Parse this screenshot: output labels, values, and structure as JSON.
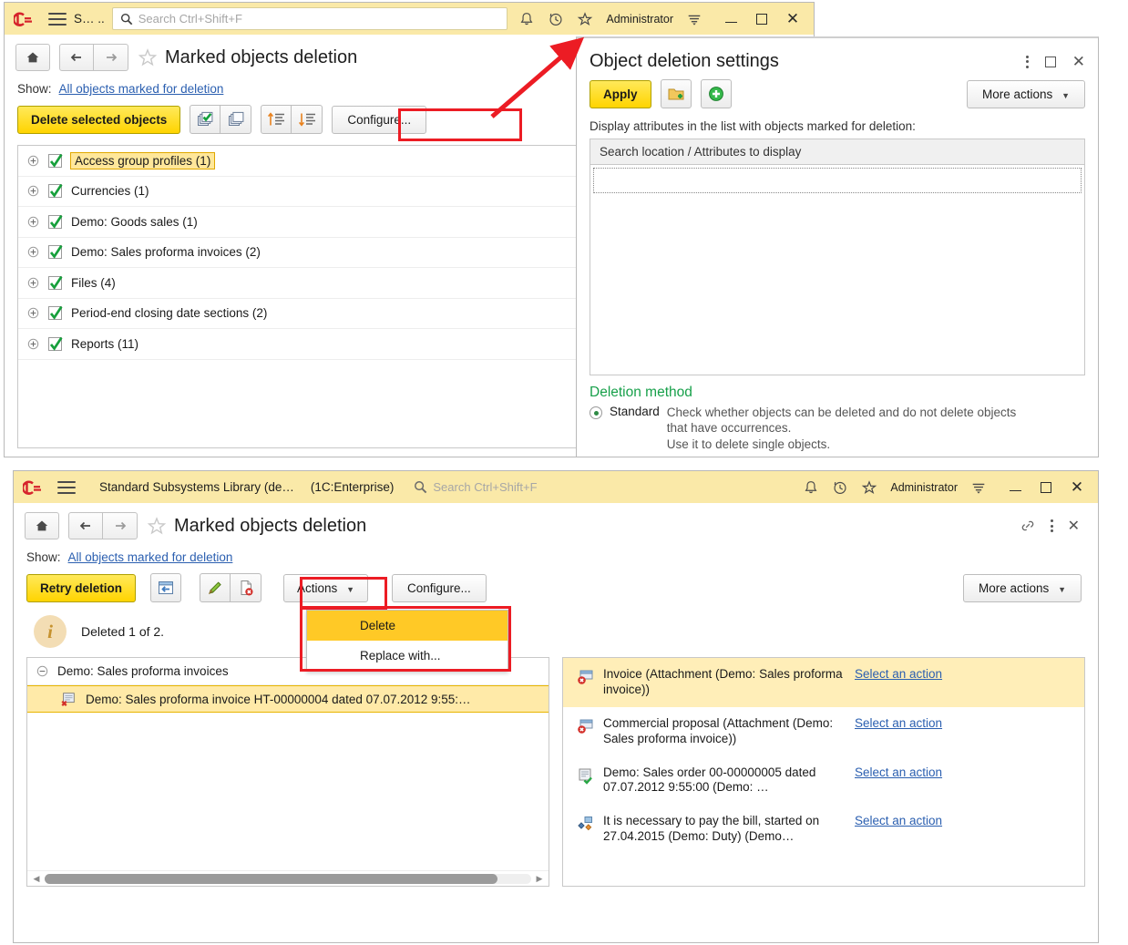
{
  "top_window": {
    "titlebar": {
      "app_title": "S… ..",
      "search_placeholder": "Search Ctrl+Shift+F",
      "user": "Administrator",
      "icons": [
        "bell-icon",
        "history-icon",
        "favorites-star-icon",
        "menu-lines-icon"
      ],
      "window_controls": [
        "minimize",
        "maximize",
        "close"
      ]
    },
    "page_title": "Marked objects deletion",
    "nav": {
      "home": "home-icon",
      "back": "back-arrow-icon",
      "forward": "forward-arrow-icon",
      "favorite": "star-icon"
    },
    "show": {
      "label": "Show:",
      "link": "All objects marked for deletion"
    },
    "toolbar": {
      "delete_selected": "Delete selected objects",
      "check_all_icon": "check-all-stack-icon",
      "uncheck_all_icon": "uncheck-all-stack-icon",
      "sort_asc_icon": "sort-ascending-icon",
      "sort_desc_icon": "sort-descending-icon",
      "configure": "Configure..."
    },
    "list": [
      {
        "label": "Access group profiles (1)",
        "checked": true,
        "selected": true
      },
      {
        "label": "Currencies (1)",
        "checked": true,
        "selected": false
      },
      {
        "label": "Demo: Goods sales (1)",
        "checked": true,
        "selected": false
      },
      {
        "label": "Demo: Sales proforma invoices (2)",
        "checked": true,
        "selected": false
      },
      {
        "label": "Files (4)",
        "checked": true,
        "selected": false
      },
      {
        "label": "Period-end closing date sections (2)",
        "checked": true,
        "selected": false
      },
      {
        "label": "Reports (11)",
        "checked": true,
        "selected": false
      }
    ]
  },
  "settings_dialog": {
    "title": "Object deletion settings",
    "controls": [
      "kebab-menu-icon",
      "maximize-icon",
      "close-icon"
    ],
    "toolbar": {
      "apply": "Apply",
      "add_folder_icon": "add-folder-icon",
      "add_item_icon": "add-green-plus-icon",
      "more_actions": "More actions"
    },
    "section_label": "Display attributes in the list with objects marked for deletion:",
    "table_header": "Search location / Attributes to display",
    "deletion_method": {
      "heading": "Deletion method",
      "option_name": "Standard",
      "option_desc_line1": "Check whether objects can be deleted and do not delete objects",
      "option_desc_line2": "that have occurrences.",
      "option_desc_line3": "Use it to delete single objects."
    }
  },
  "bottom_window": {
    "titlebar": {
      "app_title": "Standard Subsystems Library (de…",
      "app_version": "(1C:Enterprise)",
      "search_placeholder": "Search Ctrl+Shift+F",
      "user": "Administrator",
      "icons": [
        "bell-icon",
        "history-icon",
        "favorites-star-icon",
        "menu-lines-icon"
      ],
      "window_controls": [
        "minimize",
        "maximize",
        "close"
      ]
    },
    "page_title": "Marked objects deletion",
    "header_right_icons": [
      "link-icon",
      "kebab-menu-icon",
      "close-icon"
    ],
    "show": {
      "label": "Show:",
      "link": "All objects marked for deletion"
    },
    "toolbar": {
      "retry_deletion": "Retry deletion",
      "window_arrow_icon": "open-in-window-icon",
      "edit_icon": "pencil-edit-icon",
      "delete_doc_icon": "delete-document-icon",
      "actions": "Actions",
      "configure": "Configure...",
      "more_actions": "More actions"
    },
    "actions_menu": [
      {
        "label": "Delete",
        "active": true
      },
      {
        "label": "Replace with...",
        "active": false
      }
    ],
    "info": {
      "icon": "info-icon",
      "text": "Deleted 1 of 2."
    },
    "left_pane": {
      "group": "Demo: Sales proforma invoices",
      "item": "Demo: Sales proforma invoice HT-00000004 dated 07.07.2012 9:55:…",
      "item_icon": "document-deleted-icon"
    },
    "right_pane": {
      "action_link": "Select an action",
      "rows": [
        {
          "icon": "attachment-deleted-icon",
          "text": "Invoice (Attachment (Demo: Sales proforma invoice))",
          "highlighted": true
        },
        {
          "icon": "attachment-deleted-icon",
          "text": "Commercial proposal (Attachment (Demo: Sales proforma invoice))",
          "highlighted": false
        },
        {
          "icon": "document-check-icon",
          "text": "Demo: Sales order 00-00000005 dated 07.07.2012 9:55:00 (Demo: …",
          "highlighted": false
        },
        {
          "icon": "business-process-icon",
          "text": "It is necessary to pay the bill, started on 27.04.2015 (Demo: Duty) (Demo…",
          "highlighted": false
        }
      ]
    }
  },
  "annotations": {
    "highlight_color": "#ec1c24",
    "arrow": "red-arrow-configure-to-dialog"
  },
  "colors": {
    "titlebar": "#fae9a8",
    "accent_yellow": "#ffd400",
    "link": "#2b5fb0",
    "selection": "#ffeaa8",
    "green": "#17a04a"
  }
}
